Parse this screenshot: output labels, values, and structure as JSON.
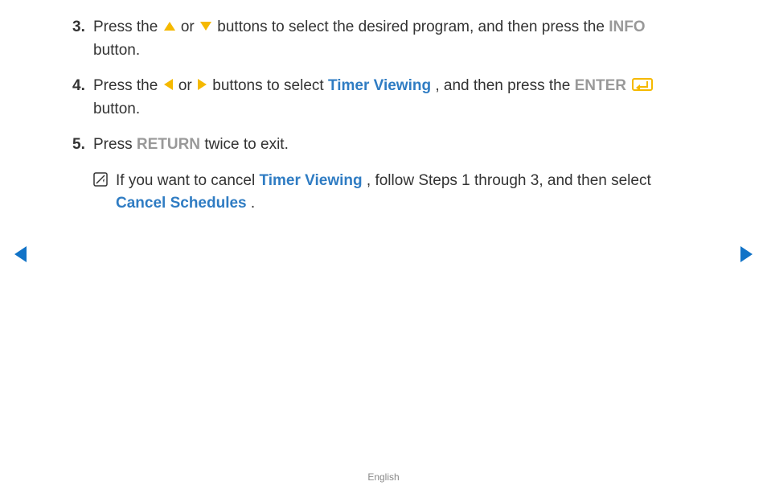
{
  "steps": {
    "3": {
      "num": "3.",
      "t1": "Press the ",
      "t2": " or ",
      "t3": " buttons to select the desired program, and then press the ",
      "btn1": "INFO",
      "t4": " button."
    },
    "4": {
      "num": "4.",
      "t1": "Press the ",
      "t2": " or ",
      "t3": " buttons to select ",
      "hl1": "Timer Viewing",
      "t4": ", and then press the ",
      "btn1": "ENTER",
      "t5": " button."
    },
    "5": {
      "num": "5.",
      "t1": "Press ",
      "btn1": "RETURN",
      "t2": " twice to exit."
    }
  },
  "note": {
    "t1": "If you want to cancel ",
    "hl1": "Timer Viewing",
    "t2": ", follow Steps 1 through 3, and then select ",
    "hl2": "Cancel Schedules",
    "t3": "."
  },
  "footer": "English"
}
